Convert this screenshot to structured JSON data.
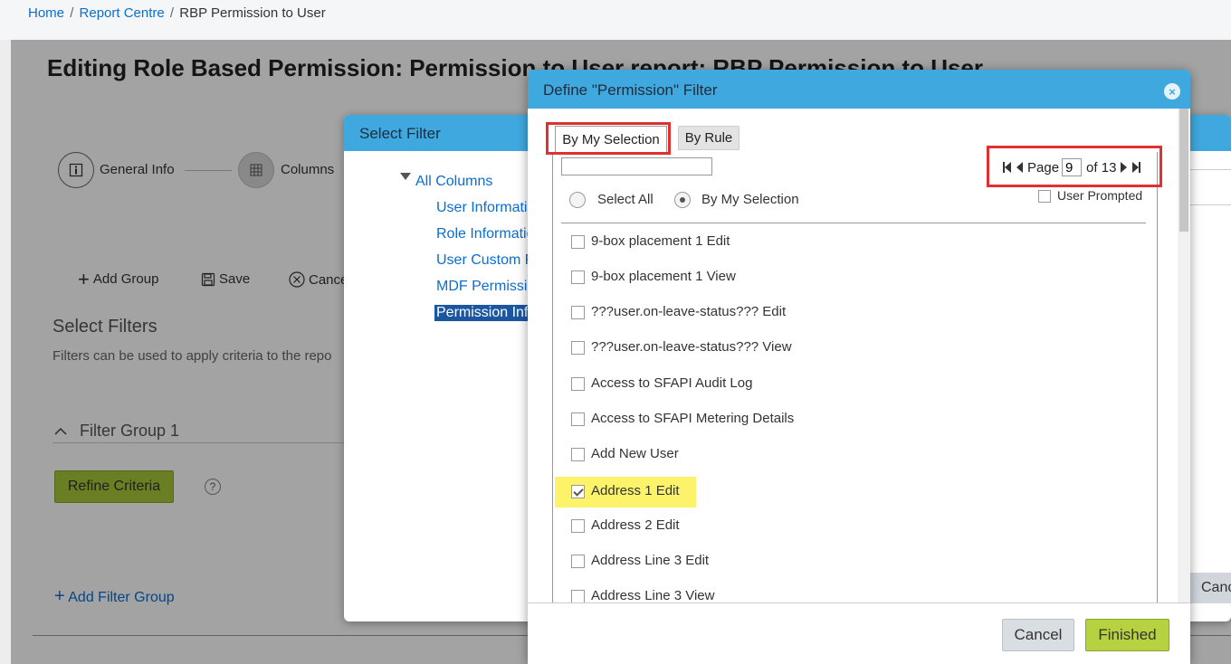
{
  "breadcrumb": {
    "home": "Home",
    "sep1": "/",
    "report_centre": "Report Centre",
    "sep2": "/",
    "current": "RBP Permission to User"
  },
  "page": {
    "title": "Editing Role Based Permission: Permission to User report: RBP Permission to User",
    "steps": [
      {
        "label": "General Info",
        "icon": "info-icon"
      },
      {
        "label": "Columns",
        "icon": "grid-icon"
      }
    ],
    "toolbar": {
      "add_group": "Add Group",
      "save": "Save",
      "cancel": "Cance"
    },
    "select_filters_heading": "Select Filters",
    "select_filters_desc": "Filters can be used to apply criteria to the repo",
    "filter_group_label": "Filter Group 1",
    "refine_criteria": "Refine Criteria",
    "help": "?",
    "add_filter_group": "Add Filter Group"
  },
  "select_filter_dialog": {
    "title": "Select Filter",
    "tree": {
      "root": "All Columns",
      "items": [
        "User Informatio",
        "Role Informatio",
        "User Custom Fi",
        "MDF Permissio",
        "Permission Info"
      ],
      "selected_index": 4
    },
    "cancel_label": "Canc"
  },
  "permission_dialog": {
    "title": "Define \"Permission\" Filter",
    "close": "×",
    "tabs": {
      "my_selection": "By My Selection",
      "by_rule": "By Rule"
    },
    "search": {
      "value": "",
      "placeholder": ""
    },
    "pager": {
      "page_label": "Page",
      "current": "9",
      "of_label": "of 13"
    },
    "radio": {
      "select_all": "Select All",
      "by_my_selection": "By My Selection",
      "selected": "by_my_selection"
    },
    "user_prompted": "User Prompted",
    "items": [
      {
        "label": "9-box placement 1 Edit",
        "checked": false
      },
      {
        "label": "9-box placement 1 View",
        "checked": false
      },
      {
        "label": "???user.on-leave-status??? Edit",
        "checked": false
      },
      {
        "label": "???user.on-leave-status??? View",
        "checked": false
      },
      {
        "label": "Access to SFAPI Audit Log",
        "checked": false
      },
      {
        "label": "Access to SFAPI Metering Details",
        "checked": false
      },
      {
        "label": "Add New User",
        "checked": false
      },
      {
        "label": "Address 1 Edit",
        "checked": true
      },
      {
        "label": "Address 2 Edit",
        "checked": false
      },
      {
        "label": "Address Line 3 Edit",
        "checked": false
      },
      {
        "label": "Address Line 3 View",
        "checked": false
      }
    ],
    "footer": {
      "cancel": "Cancel",
      "finished": "Finished"
    }
  },
  "colors": {
    "dialog_header": "#3fa9df",
    "link": "#0a6ed1",
    "accent_green": "#b7d240",
    "highlight_yellow": "#fdf36b",
    "annotation_red": "#e03030"
  }
}
